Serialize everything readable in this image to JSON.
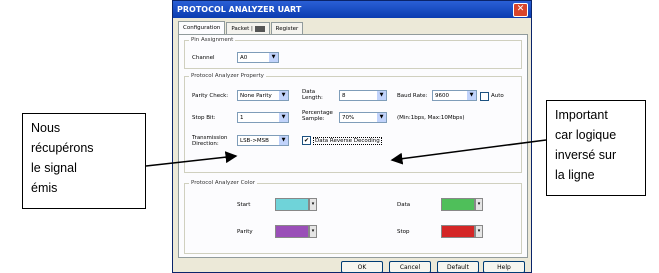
{
  "window": {
    "title": "PROTOCOL ANALYZER UART",
    "close": "✕"
  },
  "tabs": [
    "Configuration",
    "Packet",
    "Register"
  ],
  "pin_assignment": {
    "legend": "Pin Assignment",
    "channel_label": "Channel",
    "channel_value": "A0"
  },
  "property": {
    "legend": "Protocol Analyzer Property",
    "parity_label": "Parity Check:",
    "parity_value": "None Parity",
    "data_length_label_1": "Data",
    "data_length_label_2": "Length:",
    "data_length_value": "8",
    "baud_label": "Baud Rate:",
    "baud_value": "9600",
    "auto_label": "Auto",
    "stop_label": "Stop Bit:",
    "stop_value": "1",
    "pct_label_1": "Percentage",
    "pct_label_2": "Sample:",
    "pct_value": "70%",
    "range_note": "(Min:1bps, Max:10Mbps)",
    "dir_label_1": "Transmission",
    "dir_label_2": "Direction:",
    "dir_value": "LSB->MSB",
    "reverse_label": "Data Reverse Decoding",
    "reverse_checked": "✔"
  },
  "color": {
    "legend": "Protocol Analyzer Color",
    "start_label": "Start",
    "start_color": "#6fd3d9",
    "data_label": "Data",
    "data_color": "#4fbf5a",
    "parity_label": "Parity",
    "parity_color": "#9a4fb8",
    "stop_label": "Stop",
    "stop_color": "#d42626"
  },
  "buttons": {
    "ok": "OK",
    "cancel": "Cancel",
    "default": "Default",
    "help": "Help"
  },
  "annotations": {
    "left": [
      "Nous",
      "récupérons",
      "le signal",
      "émis"
    ],
    "right": [
      "Important",
      "car logique",
      "inversé sur",
      "la ligne"
    ]
  }
}
